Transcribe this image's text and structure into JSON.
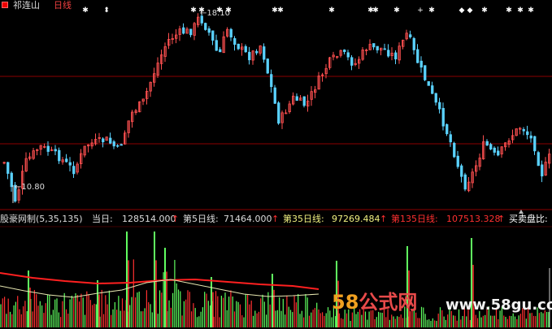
{
  "header": {
    "stock_name": "祁连山",
    "period": "日线",
    "high_marker": "←18.10",
    "low_marker": "←10.80"
  },
  "indicator": {
    "name": "股豪网制",
    "params": "(5,35,135)",
    "today_label": "当日:",
    "today_value": "128514.000",
    "ma5_label": "第5日线:",
    "ma5_value": "71464.000",
    "ma35_label": "第35日线:",
    "ma35_value": "97269.484",
    "ma135_label": "第135日线:",
    "ma135_value": "107513.328",
    "ratio_label": "买卖盘比:",
    "arrow": "↑"
  },
  "watermark": {
    "brand_digits": "58",
    "brand_text": "公式网",
    "url": "www.58gu.com"
  },
  "colors": {
    "background": "#000000",
    "up_candle": "#ff5050",
    "down_candle": "#5ad2ff",
    "grid_line": "#8b0000",
    "volume_green": "#60ff60",
    "volume_red": "#ff3030",
    "ma_red": "#ff2020",
    "ma_yellow": "#e6e6b0",
    "signal_white": "#ffffff"
  }
}
